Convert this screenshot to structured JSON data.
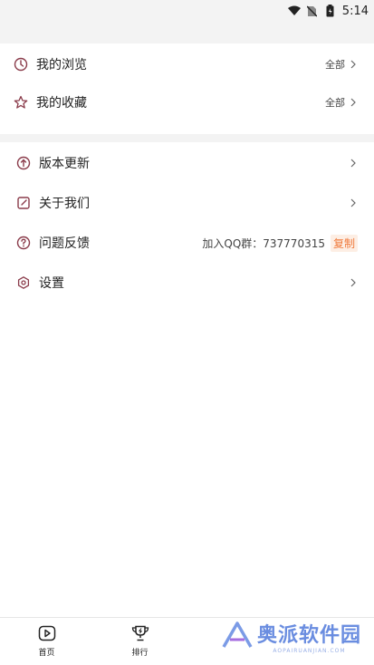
{
  "status_bar": {
    "time": "5:14"
  },
  "section1": {
    "items": [
      {
        "label": "我的浏览",
        "right": "全部",
        "icon": "clock-icon"
      },
      {
        "label": "我的收藏",
        "right": "全部",
        "icon": "star-icon"
      }
    ]
  },
  "section2": {
    "items": [
      {
        "label": "版本更新",
        "icon": "arrow-up-circle-icon"
      },
      {
        "label": "关于我们",
        "icon": "edit-icon"
      },
      {
        "label": "问题反馈",
        "icon": "question-icon",
        "qq_text": "加入QQ群：737770315",
        "copy_label": "复制"
      },
      {
        "label": "设置",
        "icon": "gear-icon"
      }
    ]
  },
  "bottom_nav": {
    "items": [
      {
        "label": "首页",
        "icon": "play-icon"
      },
      {
        "label": "排行",
        "icon": "trophy-icon"
      }
    ]
  },
  "watermark": {
    "title": "奥派软件园",
    "subtitle": "AOPAIRUANJIAN.COM"
  },
  "colors": {
    "accent": "#f07a3c",
    "icon_stroke": "#8a3b4a",
    "separator": "#f3f3f3"
  }
}
